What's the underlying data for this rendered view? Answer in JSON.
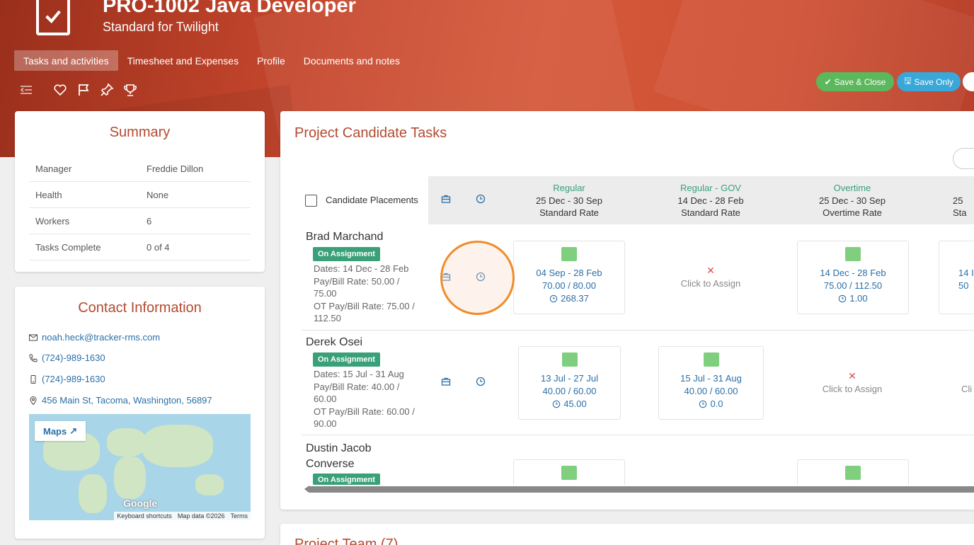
{
  "header": {
    "title": "PRO-1002 Java Developer",
    "subtitle": "Standard for Twilight",
    "tabs": [
      "Tasks and activities",
      "Timesheet and Expenses",
      "Profile",
      "Documents and notes"
    ],
    "active_tab": "Tasks and activities",
    "toolbar_icons": [
      "collapse-icon",
      "heart-icon",
      "flag-icon",
      "pin-icon",
      "trophy-icon"
    ],
    "save_close_label": "Save & Close",
    "save_only_label": "Save Only"
  },
  "summary": {
    "title": "Summary",
    "rows": [
      {
        "key": "Manager",
        "value": "Freddie Dillon"
      },
      {
        "key": "Health",
        "value": "None"
      },
      {
        "key": "Workers",
        "value": "6"
      },
      {
        "key": "Tasks Complete",
        "value": "0 of 4"
      }
    ]
  },
  "contact": {
    "title": "Contact Information",
    "email": "noah.heck@tracker-rms.com",
    "phone": "(724)-989-1630",
    "mobile": "(724)-989-1630",
    "address": "456 Main St, Tacoma, Washington, 56897",
    "maps_label": "Maps",
    "map_brand": "Google",
    "map_footer": [
      "Keyboard shortcuts",
      "Map data ©2026",
      "Terms"
    ]
  },
  "tasks": {
    "title": "Project Candidate Tasks",
    "placements_label": "Candidate Placements",
    "columns": [
      {
        "type": "Regular",
        "dates": "25 Dec - 30 Sep",
        "rate": "Standard Rate"
      },
      {
        "type": "Regular - GOV",
        "dates": "14 Dec - 28 Feb",
        "rate": "Standard Rate"
      },
      {
        "type": "Overtime",
        "dates": "25 Dec - 30 Sep",
        "rate": "Overtime Rate"
      },
      {
        "type": "",
        "dates": "25",
        "rate": "Sta"
      }
    ],
    "click_to_assign": "Click to Assign",
    "candidates": [
      {
        "name": "Brad Marchand",
        "status": "On Assignment",
        "info": [
          "Dates: 14 Dec - 28 Feb",
          "Pay/Bill Rate: 50.00 / 75.00",
          "OT Pay/Bill Rate: 75.00 / 112.50"
        ],
        "cells": [
          {
            "dates": "04 Sep - 28 Feb",
            "rates": "70.00 / 80.00",
            "hours": "268.37"
          },
          null,
          {
            "dates": "14 Dec - 28 Feb",
            "rates": "75.00 / 112.50",
            "hours": "1.00"
          },
          {
            "dates": "14 I",
            "rates": "50"
          }
        ]
      },
      {
        "name": "Derek Osei",
        "status": "On Assignment",
        "info": [
          "Dates: 15 Jul - 31 Aug",
          "Pay/Bill Rate: 40.00 / 60.00",
          "OT Pay/Bill Rate: 60.00 / 90.00"
        ],
        "cells": [
          {
            "dates": "13 Jul - 27 Jul",
            "rates": "40.00 / 60.00",
            "hours": "45.00"
          },
          {
            "dates": "15 Jul - 31 Aug",
            "rates": "40.00 / 60.00",
            "hours": "0.0"
          },
          null,
          {
            "partial": "Cli"
          }
        ]
      },
      {
        "name": "Dustin Jacob Converse",
        "status": "On Assignment"
      }
    ]
  },
  "team": {
    "title": "Project Team (7)"
  }
}
